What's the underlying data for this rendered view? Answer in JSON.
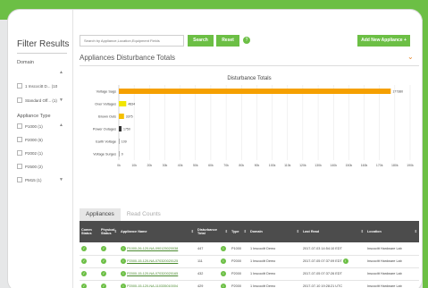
{
  "filters": {
    "title": "Filter Results",
    "domain_label": "Domain",
    "domain_items": [
      {
        "label": "1 Inscocitt D... (10"
      },
      {
        "label": "Standard Off... (1)"
      }
    ],
    "appliance_label": "Appliance Type",
    "appliance_items": [
      {
        "label": "P1000 (1)"
      },
      {
        "label": "P2000 (6)"
      },
      {
        "label": "P2002 (1)"
      },
      {
        "label": "P2500 (2)"
      },
      {
        "label": "PM15 (1)"
      }
    ]
  },
  "toolbar": {
    "search_placeholder": "Search by Appliance,Location,Equipment Fields",
    "search_label": "Search",
    "reset_label": "Reset",
    "help": "?",
    "add_label": "Add New Appliance  +"
  },
  "section": {
    "title": "Appliances Disturbance Totals",
    "collapse": "⌄"
  },
  "chart_data": {
    "type": "bar",
    "orientation": "horizontal",
    "title": "Disturbance Totals",
    "categories": [
      "Voltage Sags",
      "Over Voltages",
      "Brown Outs",
      "Power Outages",
      "Earth Voltage",
      "Voltage Surges"
    ],
    "values": [
      177380,
      4834,
      3375,
      1750,
      109,
      0
    ],
    "value_labels": [
      "177380",
      "4834",
      "3375",
      "1750",
      "109",
      "0"
    ],
    "bar_colors": [
      "#f5a000",
      "#f2e600",
      "#f5c000",
      "#333333",
      "#999999",
      "#999999"
    ],
    "xlim": [
      0,
      190000
    ],
    "xticks": [
      "0k",
      "10k",
      "20k",
      "30k",
      "40k",
      "50k",
      "60k",
      "70k",
      "80k",
      "90k",
      "100k",
      "110k",
      "120k",
      "130k",
      "140k",
      "150k",
      "160k",
      "170k",
      "180k",
      "190k"
    ],
    "grid": true
  },
  "tabs": [
    {
      "label": "Appliances",
      "active": true
    },
    {
      "label": "Read Counts",
      "active": false
    }
  ],
  "table": {
    "headers": [
      "Comm Status",
      "Physical Status",
      "Appliance Name",
      "Disturbance Total",
      "",
      "Type",
      "Domain",
      "Last Read",
      "Location"
    ],
    "rows": [
      {
        "name": "P1000-26-120-NA-090125020038",
        "total": "447",
        "type": "P1000",
        "domain": "1 Inscocitt Demo",
        "last_read": "2017-07-03 14:54:10 EDT",
        "location": "Inscocitt Hardware Lab"
      },
      {
        "name": "P2000-15-120-NA-070320020125",
        "total": "111",
        "type": "P2000",
        "domain": "1 Inscocitt Demo",
        "last_read": "2017-07-05 07:37:09 EDT",
        "location": "Inscocitt Hardware Lab"
      },
      {
        "name": "P2000-15-120-NA-070320020165",
        "total": "432",
        "type": "P2000",
        "domain": "1 Inscocitt Demo",
        "last_read": "2017-07-05 07:37:26 EDT",
        "location": "Inscocitt Hardware Lab"
      },
      {
        "name": "P2000-15-120-NA-110335010004",
        "total": "429",
        "type": "P2000",
        "domain": "1 Inscocitt Demo",
        "last_read": "2017-07-10 19:28:21 UTC",
        "location": "Inscocitt Hardware Lab"
      }
    ]
  }
}
